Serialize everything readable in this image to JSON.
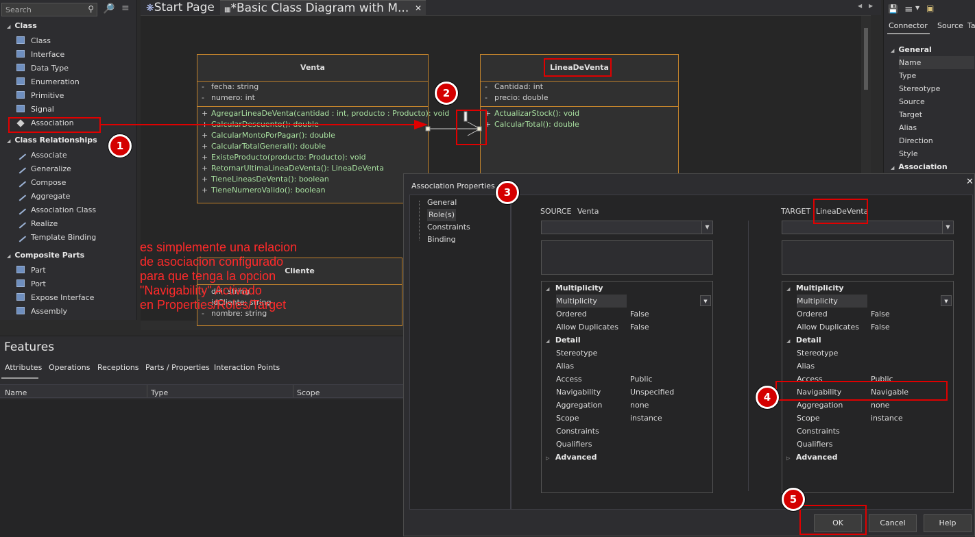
{
  "toolbox": {
    "search_placeholder": "Search",
    "sections": [
      {
        "title": "Class",
        "items": [
          "Class",
          "Interface",
          "Data Type",
          "Enumeration",
          "Primitive",
          "Signal",
          "Association"
        ]
      },
      {
        "title": "Class Relationships",
        "items": [
          "Associate",
          "Generalize",
          "Compose",
          "Aggregate",
          "Association Class",
          "Realize",
          "Template Binding"
        ]
      },
      {
        "title": "Composite Parts",
        "items": [
          "Part",
          "Port",
          "Expose Interface",
          "Assembly"
        ]
      }
    ]
  },
  "tabs": [
    {
      "label": "Start Page",
      "icon": "start-page-icon"
    },
    {
      "label": "*Basic Class Diagram with M...",
      "icon": "diagram-icon"
    }
  ],
  "diagram": {
    "venta": {
      "name": "Venta",
      "attributes": [
        {
          "vis": "-",
          "text": "fecha: string"
        },
        {
          "vis": "-",
          "text": "numero: int"
        }
      ],
      "operations": [
        {
          "vis": "+",
          "text": "AgregarLineaDeVenta(cantidad : int, producto : Producto): void"
        },
        {
          "vis": "+",
          "text": "CalcularDescuento(): double"
        },
        {
          "vis": "+",
          "text": "CalcularMontoPorPagar(): double"
        },
        {
          "vis": "+",
          "text": "CalcularTotalGeneral(): double"
        },
        {
          "vis": "+",
          "text": "ExisteProducto(producto: Producto): void"
        },
        {
          "vis": "+",
          "text": "RetornarUltimaLineaDeVenta(): LineaDeVenta"
        },
        {
          "vis": "+",
          "text": "TieneLineasDeVenta(): boolean"
        },
        {
          "vis": "+",
          "text": "TieneNumeroValido(): boolean"
        }
      ]
    },
    "linea": {
      "name": "LineaDeVenta",
      "attributes": [
        {
          "vis": "-",
          "text": "Cantidad: int"
        },
        {
          "vis": "-",
          "text": "precio: double"
        }
      ],
      "operations": [
        {
          "vis": "+",
          "text": "ActualizarStock(): void"
        },
        {
          "vis": "+",
          "text": "CalcularTotal(): double"
        }
      ]
    },
    "cliente": {
      "name": "Cliente",
      "attributes": [
        {
          "vis": "-",
          "text": "dni: string"
        },
        {
          "vis": "-",
          "text": "idCliente: string"
        },
        {
          "vis": "-",
          "text": "nombre: string"
        }
      ]
    }
  },
  "right_panel": {
    "tabs": [
      "Connector",
      "Source",
      "Ta"
    ],
    "groups": [
      {
        "title": "General",
        "rows": [
          "Name",
          "Type",
          "Stereotype",
          "Source",
          "Target",
          "Alias",
          "Direction",
          "Style"
        ]
      },
      {
        "title": "Association",
        "rows": []
      }
    ]
  },
  "features": {
    "title": "Features",
    "tabs": [
      "Attributes",
      "Operations",
      "Receptions",
      "Parts / Properties",
      "Interaction Points"
    ],
    "columns": [
      "Name",
      "Type",
      "Scope"
    ]
  },
  "dialog": {
    "title": "Association Properties",
    "nav": [
      "General",
      "Role(s)",
      "Constraints",
      "Binding"
    ],
    "source": {
      "label": "SOURCE",
      "value": "Venta",
      "groups": [
        {
          "title": "Multiplicity",
          "rows": [
            {
              "k": "Multiplicity",
              "v": ""
            },
            {
              "k": "Ordered",
              "v": "False"
            },
            {
              "k": "Allow Duplicates",
              "v": "False"
            }
          ]
        },
        {
          "title": "Detail",
          "rows": [
            {
              "k": "Stereotype",
              "v": ""
            },
            {
              "k": "Alias",
              "v": ""
            },
            {
              "k": "Access",
              "v": "Public"
            },
            {
              "k": "Navigability",
              "v": "Unspecified"
            },
            {
              "k": "Aggregation",
              "v": "none"
            },
            {
              "k": "Scope",
              "v": "instance"
            },
            {
              "k": "Constraints",
              "v": ""
            },
            {
              "k": "Qualifiers",
              "v": ""
            }
          ]
        },
        {
          "title": "Advanced",
          "rows": []
        }
      ]
    },
    "target": {
      "label": "TARGET",
      "value": "LineaDeVenta",
      "groups": [
        {
          "title": "Multiplicity",
          "rows": [
            {
              "k": "Multiplicity",
              "v": ""
            },
            {
              "k": "Ordered",
              "v": "False"
            },
            {
              "k": "Allow Duplicates",
              "v": "False"
            }
          ]
        },
        {
          "title": "Detail",
          "rows": [
            {
              "k": "Stereotype",
              "v": ""
            },
            {
              "k": "Alias",
              "v": ""
            },
            {
              "k": "Access",
              "v": "Public"
            },
            {
              "k": "Navigability",
              "v": "Navigable"
            },
            {
              "k": "Aggregation",
              "v": "none"
            },
            {
              "k": "Scope",
              "v": "instance"
            },
            {
              "k": "Constraints",
              "v": ""
            },
            {
              "k": "Qualifiers",
              "v": ""
            }
          ]
        },
        {
          "title": "Advanced",
          "rows": []
        }
      ]
    },
    "buttons": {
      "ok": "OK",
      "cancel": "Cancel",
      "help": "Help"
    }
  },
  "annotations": {
    "badges": [
      "1",
      "2",
      "3",
      "4",
      "5"
    ],
    "note": "es simplemente una relacion\nde asociacion configurado\npara que tenga la opcion\n\"Navigability\" Activado\nen Properties/Roles/Target",
    "color": "#e00000"
  }
}
